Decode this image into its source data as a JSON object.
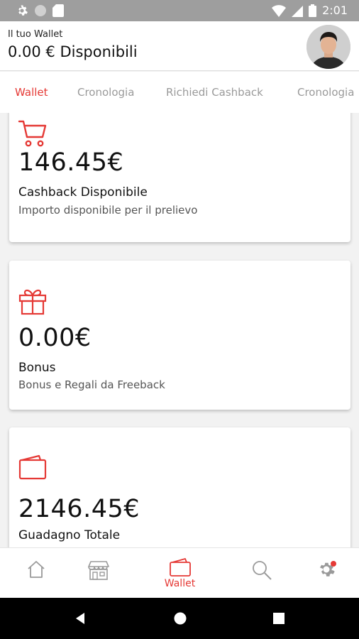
{
  "status_bar": {
    "time": "2:01"
  },
  "header": {
    "subtitle": "Il tuo Wallet",
    "title": "0.00 € Disponibili"
  },
  "tabs": [
    {
      "label": "Wallet",
      "active": true
    },
    {
      "label": "Cronologia",
      "active": false
    },
    {
      "label": "Richiedi Cashback",
      "active": false
    },
    {
      "label": "Cronologia",
      "active": false
    }
  ],
  "cards": [
    {
      "icon": "cart-icon",
      "amount": "146.45€",
      "label": "Cashback Disponibile",
      "description": "Importo disponibile per il prelievo"
    },
    {
      "icon": "gift-icon",
      "amount": "0.00€",
      "label": "Bonus",
      "description": "Bonus e Regali da Freeback"
    },
    {
      "icon": "wallet-icon",
      "amount": "2146.45€",
      "label": "Guadagno Totale",
      "description": ""
    }
  ],
  "bottom_nav": [
    {
      "icon": "home-icon",
      "label": ""
    },
    {
      "icon": "store-icon",
      "label": ""
    },
    {
      "icon": "wallet-icon",
      "label": "Wallet",
      "active": true
    },
    {
      "icon": "search-icon",
      "label": ""
    },
    {
      "icon": "settings-icon",
      "label": ""
    }
  ],
  "colors": {
    "accent": "#e53935",
    "inactive": "#9a9a9a",
    "status_bar": "#9e9e9e"
  }
}
